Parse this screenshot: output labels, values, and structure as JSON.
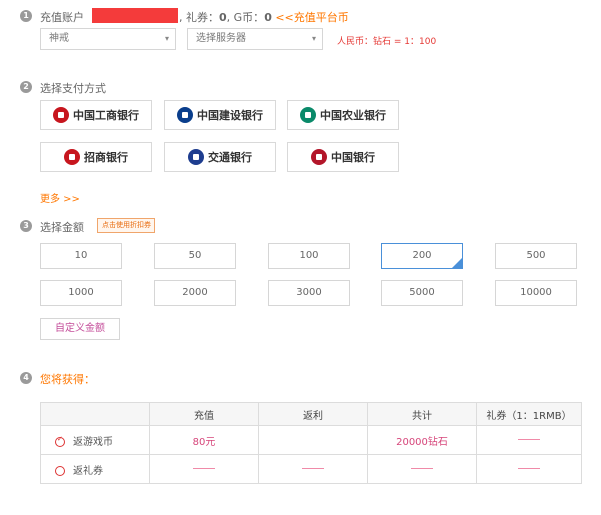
{
  "account": {
    "label": "充值账户",
    "separator": ",",
    "coupon_label": "礼券：",
    "coupon_value": "0",
    "gb_label": "G币：",
    "gb_value": "0",
    "platform_link": "<<充值平台币"
  },
  "selects": {
    "game": {
      "value": "神戒",
      "icon": "chevron-down-icon"
    },
    "server": {
      "placeholder": "选择服务器",
      "icon": "chevron-down-icon"
    },
    "rate_text": "人民币：钻石 = 1：100"
  },
  "steps": [
    {
      "num": "1"
    },
    {
      "num": "2",
      "label": "选择支付方式"
    },
    {
      "num": "3",
      "label": "选择金额"
    },
    {
      "num": "4",
      "label": "您将获得："
    }
  ],
  "banks": [
    {
      "name": "中国工商银行",
      "color": "#c7161e"
    },
    {
      "name": "中国建设银行",
      "color": "#0a3e8c"
    },
    {
      "name": "中国农业银行",
      "color": "#0a8a6a"
    },
    {
      "name": "招商银行",
      "color": "#c7161e"
    },
    {
      "name": "交通银行",
      "color": "#1e3d8f"
    },
    {
      "name": "中国银行",
      "color": "#b3162a"
    }
  ],
  "more_link": "更多 >>",
  "discount_tag": "点击使用折扣券",
  "amounts": [
    "10",
    "50",
    "100",
    "200",
    "500",
    "1000",
    "2000",
    "3000",
    "5000",
    "10000"
  ],
  "selected_amount": "200",
  "custom_amount_label": "自定义金额",
  "result_table": {
    "headers": [
      "",
      "充值",
      "返利",
      "共计",
      "礼券（1：1RMB）"
    ],
    "rows": [
      {
        "option": "返游戏币",
        "checked": true,
        "recharge": "80元",
        "rebate": "",
        "total": "20000钻石",
        "coupon": ""
      },
      {
        "option": "返礼券",
        "checked": false,
        "recharge": "",
        "rebate": "",
        "total": "",
        "coupon": ""
      }
    ]
  },
  "colors": {
    "accent_orange": "#ff7700",
    "red": "#e53935",
    "selected_blue": "#4a90d9",
    "pink": "#d6457a"
  }
}
